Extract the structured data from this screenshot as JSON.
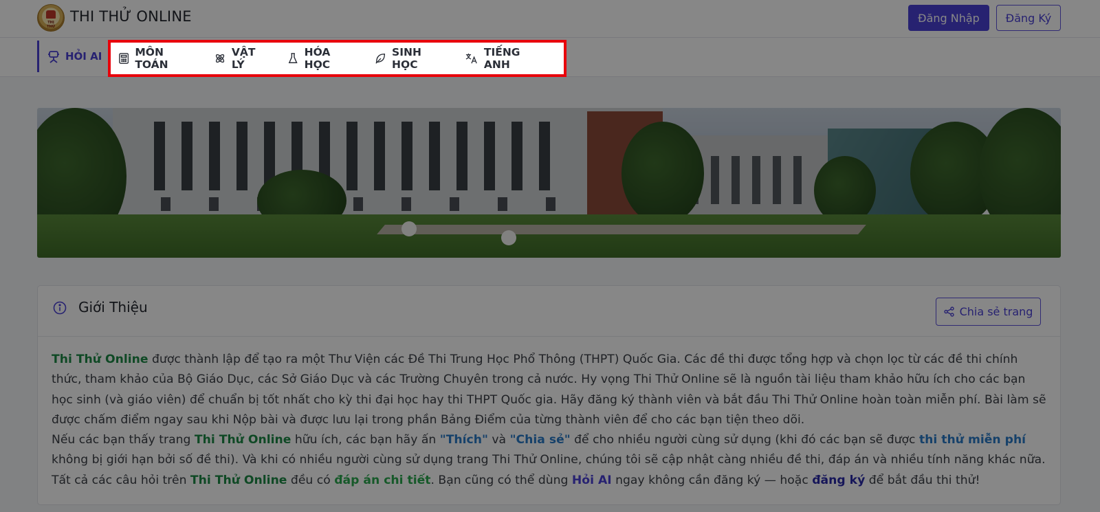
{
  "header": {
    "site_title": "THI THỬ ONLINE",
    "logo_text": "THI THỬ",
    "login_label": "Đăng Nhập",
    "register_label": "Đăng Ký"
  },
  "nav": {
    "ai_label": "HỎI AI",
    "items": [
      {
        "label": "MÔN TOÁN",
        "icon": "calculator-icon"
      },
      {
        "label": "VẬT LÝ",
        "icon": "atom-icon"
      },
      {
        "label": "HÓA HỌC",
        "icon": "flask-icon"
      },
      {
        "label": "SINH HỌC",
        "icon": "leaf-icon"
      },
      {
        "label": "TIẾNG ANH",
        "icon": "translate-icon"
      }
    ]
  },
  "intro": {
    "title": "Giới Thiệu",
    "share_label": "Chia sẻ trang",
    "p1_brand": "Thi Thử Online",
    "p1_text": " được thành lập để tạo ra một Thư Viện các Đề Thi Trung Học Phổ Thông (THPT) Quốc Gia. Các đề thi được tổng hợp và chọn lọc từ các đề thi chính thức, tham khảo của Bộ Giáo Dục, các Sở Giáo Dục và các Trường Chuyên trong cả nước. Hy vọng Thi Thử Online sẽ là nguồn tài liệu tham khảo hữu ích cho các bạn học sinh (và giáo viên) để chuẩn bị tốt nhất cho kỳ thi đại học hay thi THPT Quốc gia. Hãy đăng ký thành viên và bắt đầu Thi Thử Online hoàn toàn miễn phí. Bài làm sẽ được chấm điểm ngay sau khi Nộp bài và được lưu lại trong phần Bảng Điểm của từng thành viên để cho các bạn tiện theo dõi.",
    "p2_a": "Nếu các bạn thấy trang ",
    "p2_brand": "Thi Thử Online",
    "p2_b": " hữu ích, các bạn hãy ấn ",
    "p2_like": "\"Thích\"",
    "p2_c": " và ",
    "p2_share": "\"Chia sẻ\"",
    "p2_d": " để cho nhiều người cùng sử dụng (khi đó các bạn sẽ được ",
    "p2_free": "thi thử miễn phí",
    "p2_e": " không bị giới hạn bởi số đề thi). Và khi có nhiều người cùng sử dụng trang Thi Thử Online, chúng tôi sẽ cập nhật càng nhiều đề thi, đáp án và nhiều tính năng khác nữa.",
    "p3_a": "Tất cả các câu hỏi trên ",
    "p3_brand": "Thi Thử Online",
    "p3_b": " đều có ",
    "p3_answers": "đáp án chi tiết",
    "p3_c": ". Bạn cũng có thể dùng ",
    "p3_ai": "Hỏi AI",
    "p3_d": " ngay không cần đăng ký — hoặc ",
    "p3_register": "đăng ký",
    "p3_e": " để bắt đầu thi thử!"
  },
  "colors": {
    "accent": "#4b40d6",
    "highlight_box": "#e8000b",
    "brand_green": "#1e8a47"
  }
}
